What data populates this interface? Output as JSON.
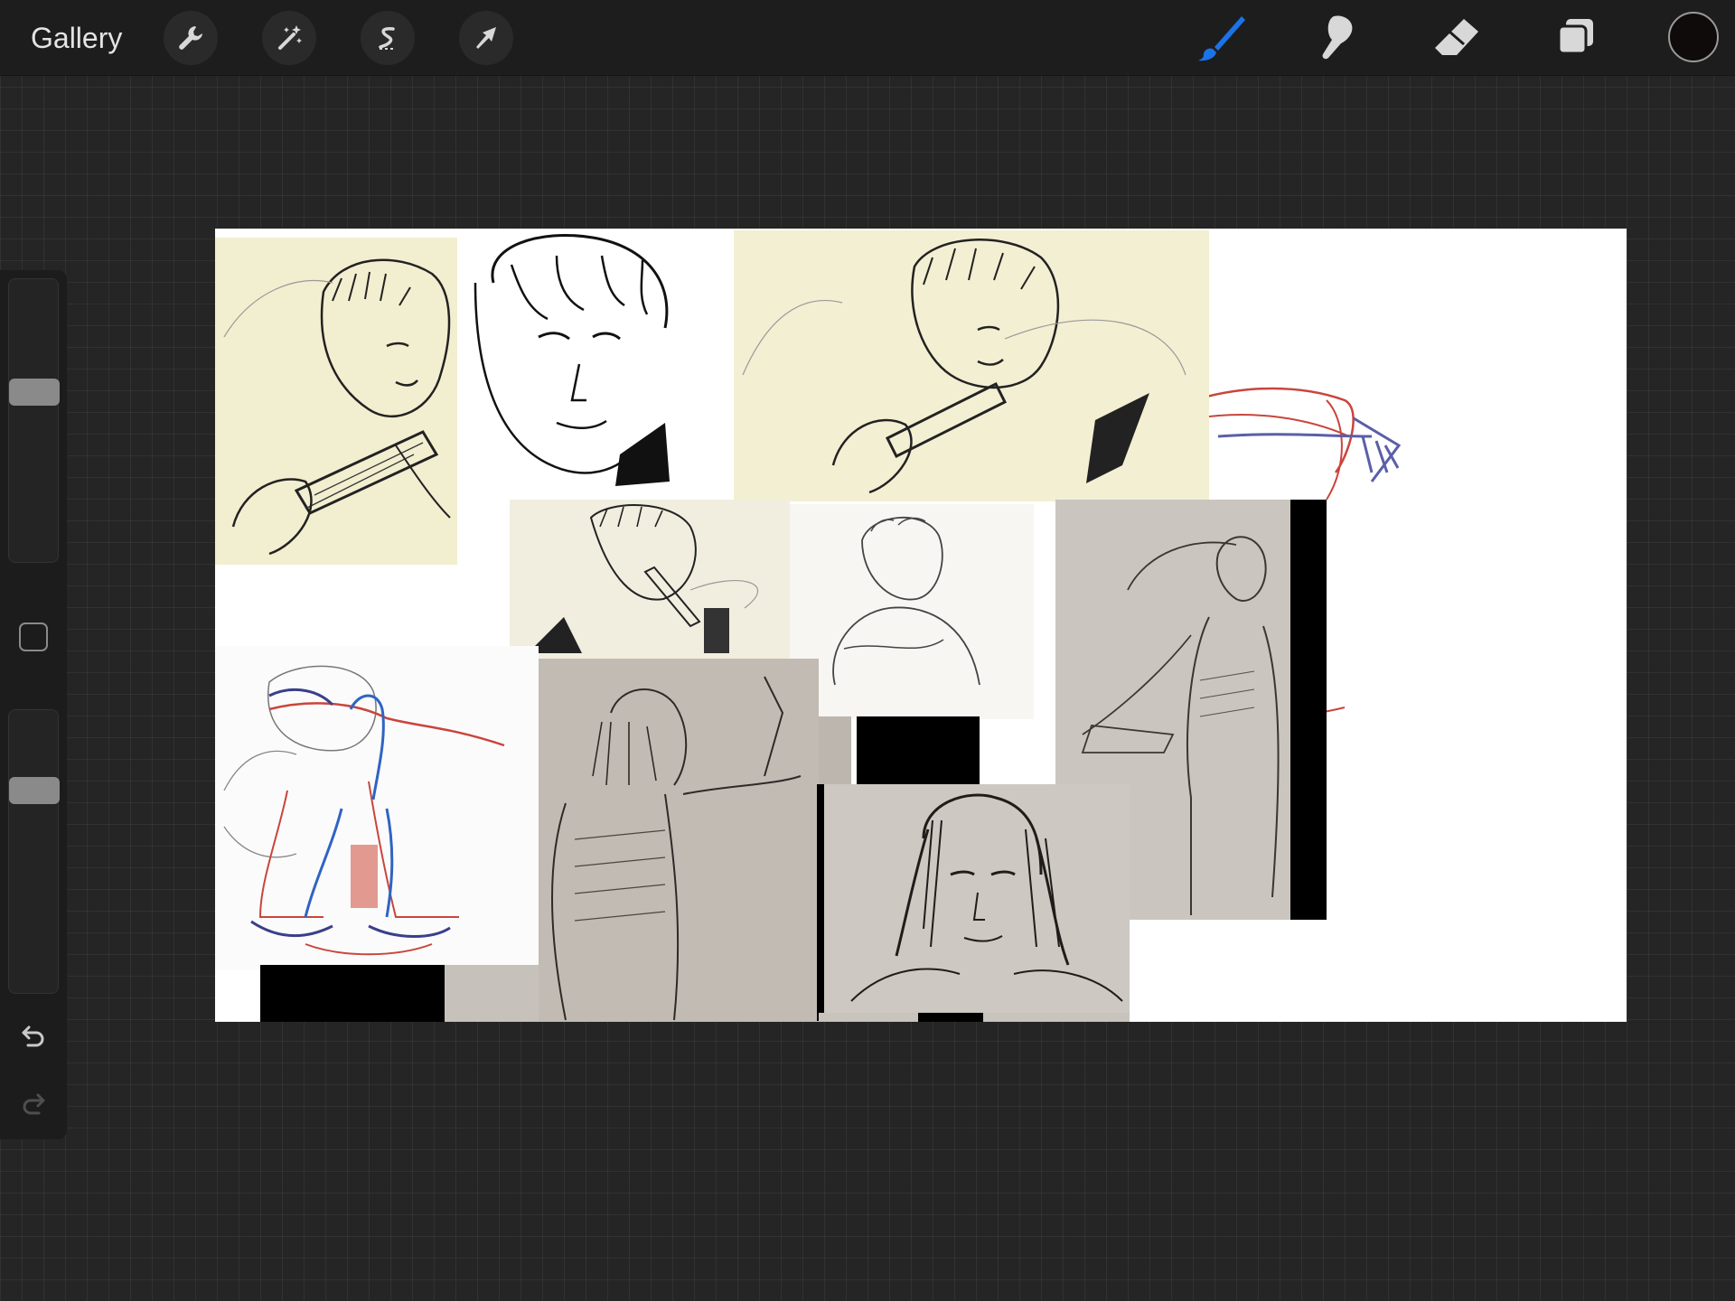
{
  "toolbar": {
    "gallery_label": "Gallery",
    "left_tools": [
      {
        "name": "actions",
        "icon": "wrench-icon"
      },
      {
        "name": "adjustments",
        "icon": "magic-wand-icon"
      },
      {
        "name": "selection",
        "icon": "selection-s-icon"
      },
      {
        "name": "transform",
        "icon": "arrow-cursor-icon"
      }
    ],
    "right_tools": [
      {
        "name": "brush",
        "icon": "brush-icon",
        "active": true
      },
      {
        "name": "smudge",
        "icon": "smudge-finger-icon",
        "active": false
      },
      {
        "name": "eraser",
        "icon": "eraser-icon",
        "active": false
      },
      {
        "name": "layers",
        "icon": "layers-icon",
        "active": false
      }
    ],
    "current_color": "#0f0b0a",
    "active_color": "#1a73e8"
  },
  "sidebar": {
    "brush_size_level": 0.39,
    "opacity_level": 0.26,
    "modify_icon": "square-icon",
    "undo_icon": "undo-icon",
    "redo_icon": "redo-icon"
  }
}
